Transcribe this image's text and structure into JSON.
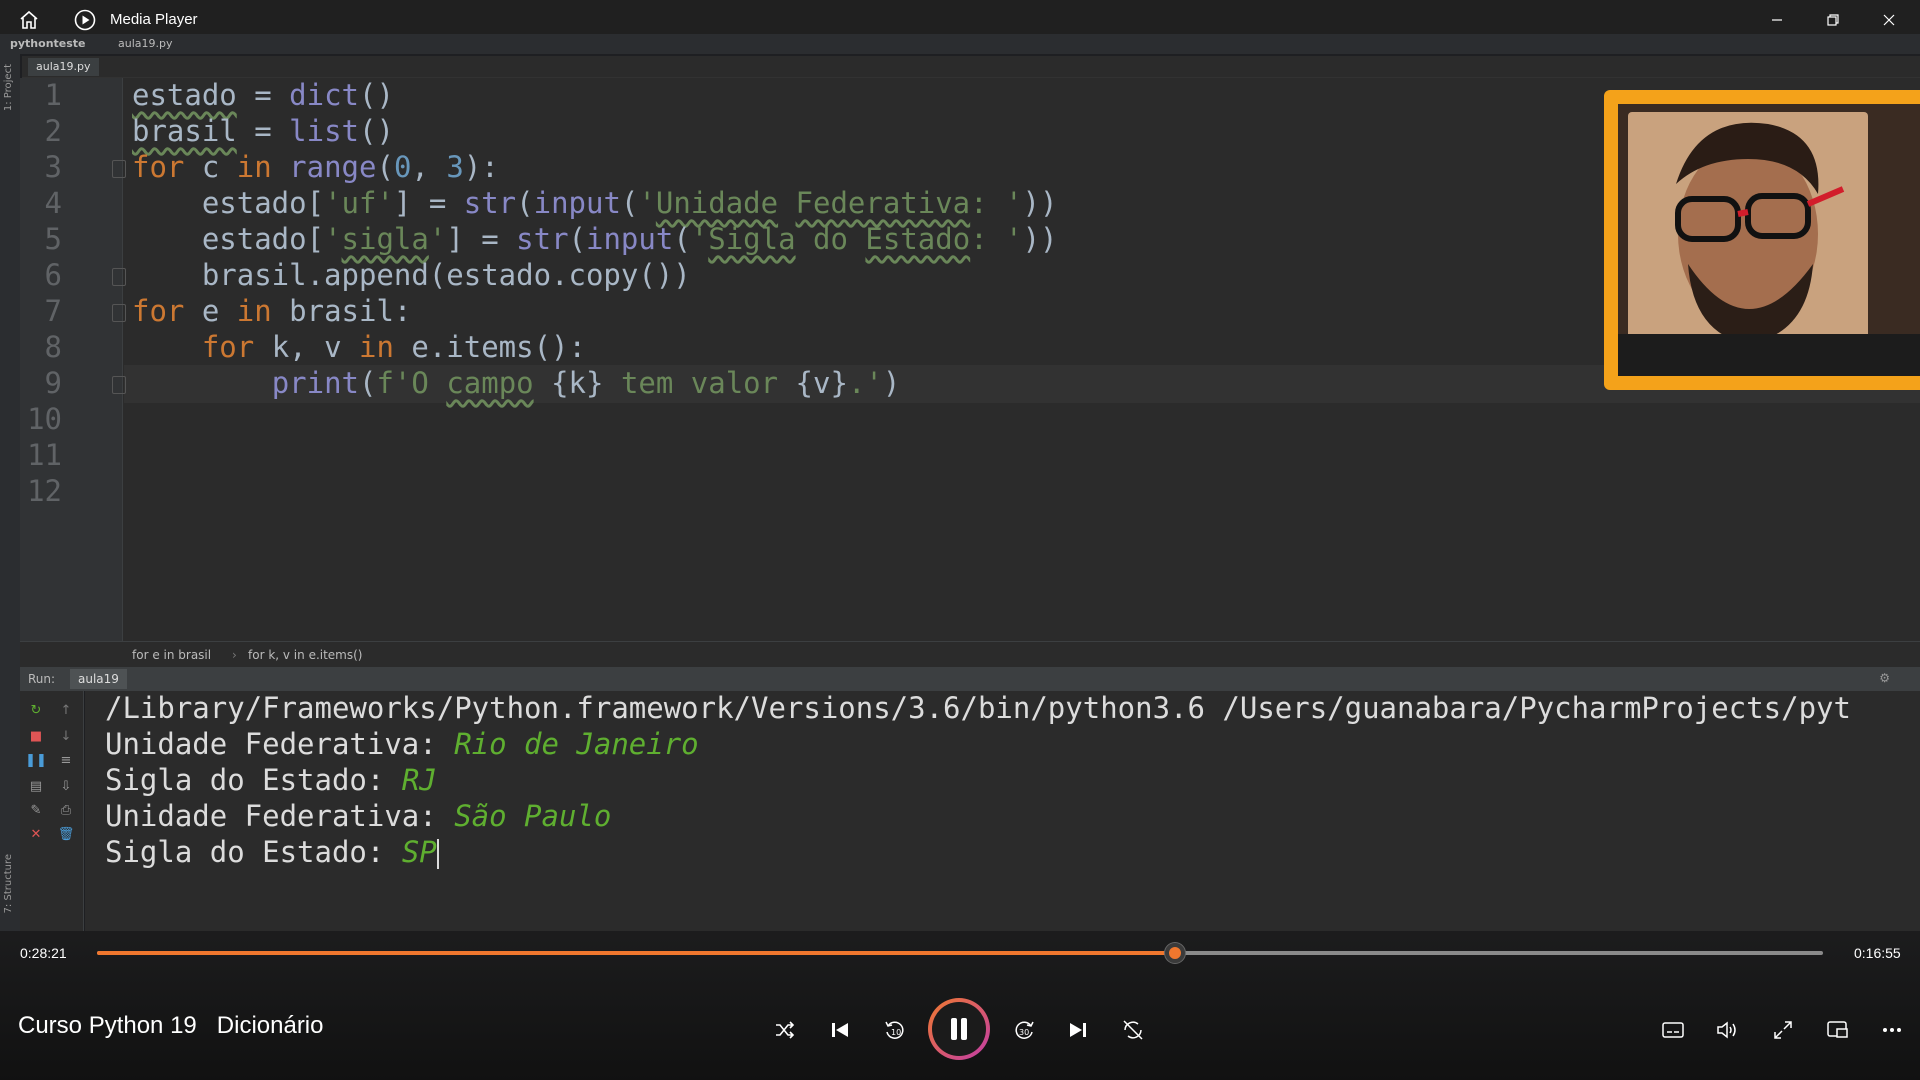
{
  "window": {
    "title": "Media Player"
  },
  "ide": {
    "project": "pythonteste",
    "file": "aula19.py",
    "tab": "aula19.py",
    "left_strip": {
      "project": "1: Project",
      "structure": "7: Structure"
    },
    "breadcrumbs": [
      "for e in brasil",
      "for k, v in e.items()"
    ],
    "line_numbers": [
      "1",
      "2",
      "3",
      "4",
      "5",
      "6",
      "7",
      "8",
      "9",
      "10",
      "11",
      "12"
    ],
    "run": {
      "label": "Run:",
      "tab": "aula19"
    },
    "console": {
      "line1": "/Library/Frameworks/Python.framework/Versions/3.6/bin/python3.6 /Users/guanabara/PycharmProjects/pyt",
      "prompt1": "Unidade Federativa: ",
      "input1": "Rio de Janeiro",
      "prompt2": "Sigla do Estado: ",
      "input2": "RJ",
      "prompt3": "Unidade Federativa: ",
      "input3": "São Paulo",
      "prompt4": "Sigla do Estado: ",
      "input4": "SP"
    }
  },
  "player": {
    "elapsed": "0:28:21",
    "remaining": "0:16:55",
    "progress": 0.6244,
    "title": "Curso Python 19   Dicionário",
    "accent": "#f0772e",
    "controls": [
      "shuffle-icon",
      "previous-icon",
      "rewind-10-icon",
      "pause-icon",
      "forward-30-icon",
      "next-icon",
      "repeat-off-icon",
      "subtitles-icon",
      "volume-icon",
      "fullscreen-icon",
      "mini-player-icon",
      "more-icon"
    ]
  }
}
